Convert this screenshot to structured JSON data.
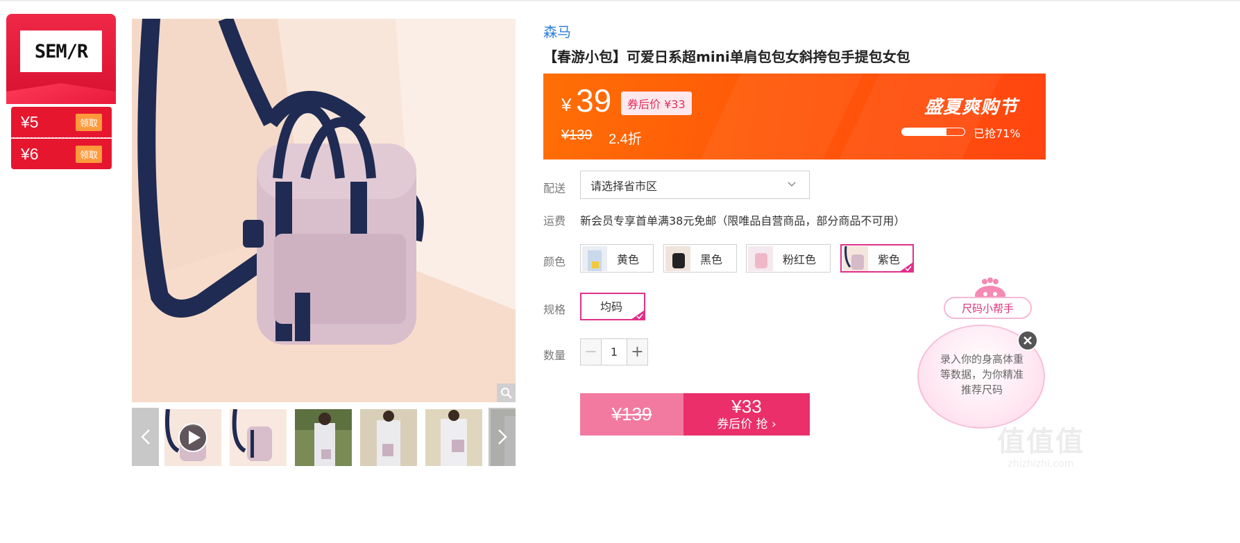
{
  "brand_badge": {
    "logo_text": "SEM/R"
  },
  "coupons": [
    {
      "amount": "¥5",
      "button": "领取"
    },
    {
      "amount": "¥6",
      "button": "领取"
    }
  ],
  "gallery": {
    "prev_icon": "chevron-left-icon",
    "next_icon": "chevron-right-icon",
    "zoom_icon": "magnifier-icon",
    "play_icon": "play-icon"
  },
  "product": {
    "brand": "森马",
    "title": "【春游小包】可爱日系超mini单肩包包女斜挎包手提包女包"
  },
  "price_banner": {
    "currency": "¥",
    "price": "39",
    "coupon_price": "券后价 ¥33",
    "original_price": "¥139",
    "discount": "2.4折",
    "promo_title": "盛夏爽购节",
    "sold_progress": 0.71,
    "sold_text": "已抢71%",
    "colors": {
      "start": "#ff6f06",
      "end": "#ff4510"
    }
  },
  "options": {
    "delivery_label": "配送",
    "delivery_placeholder": "请选择省市区",
    "shipping_label": "运费",
    "shipping_text": "新会员专享首单满38元免邮（限唯品自营商品，部分商品不可用）",
    "color_label": "颜色",
    "colors": [
      "黄色",
      "黑色",
      "粉红色",
      "紫色"
    ],
    "selected_color": "紫色",
    "size_label": "规格",
    "size": "均码",
    "qty_label": "数量",
    "qty": "1",
    "minus": "−",
    "plus": "+"
  },
  "buy": {
    "original_price": "¥139",
    "coupon_price": "¥33",
    "action": "券后价 抢 ›"
  },
  "size_helper": {
    "pill": "尺码小帮手",
    "text": "录入你的身高体重等数据，为你精准推荐尺码"
  },
  "watermark": {
    "big": "值值值",
    "small": "zhizhizhi.com"
  },
  "accent_colors": {
    "pink": "#e0308a",
    "red": "#e6162f",
    "link": "#2e7fd8"
  }
}
